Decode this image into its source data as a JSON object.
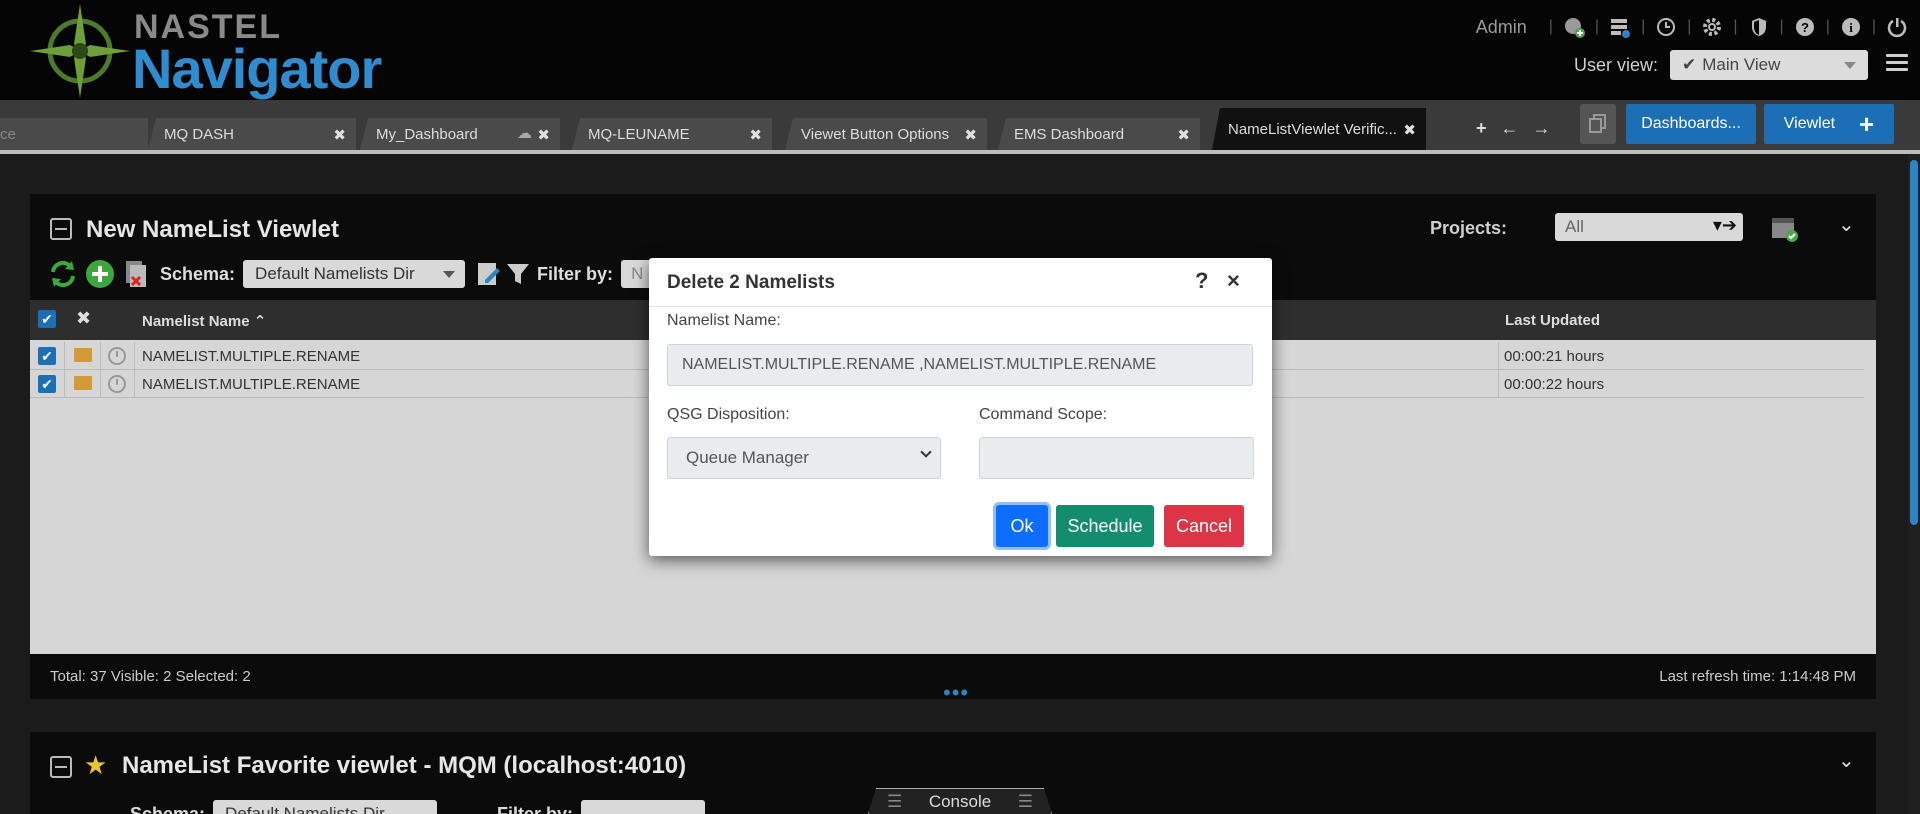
{
  "header": {
    "brand_top": "NASTEL",
    "brand_main": "Navigator",
    "admin_label": "Admin",
    "user_view_label": "User view:",
    "user_view_value": "Main View",
    "icons": [
      "globe-plus-icon",
      "server-icon",
      "clock-icon",
      "gear-icon",
      "shield-icon",
      "help-icon",
      "info-icon",
      "power-icon"
    ]
  },
  "tabs": [
    {
      "label": "ce",
      "closable": false
    },
    {
      "label": "MQ DASH",
      "closable": true
    },
    {
      "label": "My_Dashboard",
      "closable": true
    },
    {
      "label": "MQ-LEUNAME",
      "closable": true
    },
    {
      "label": "Viewet Button Options",
      "closable": true
    },
    {
      "label": "EMS Dashboard",
      "closable": true
    },
    {
      "label": "NameListViewlet Verific...",
      "closable": true,
      "active": true
    }
  ],
  "tab_actions": {
    "add": "+",
    "prev": "←",
    "next": "→",
    "dashboards_label": "Dashboards...",
    "viewlet_label": "Viewlet",
    "viewlet_plus": "+"
  },
  "viewlet": {
    "title": "New NameList Viewlet",
    "projects_label": "Projects:",
    "projects_value": "All",
    "schema_label": "Schema:",
    "schema_value": "Default Namelists Dir",
    "filter_label": "Filter by:",
    "filter_placeholder": "N",
    "columns": {
      "name": "Namelist Name ⌃",
      "updated": "Last Updated"
    },
    "rows": [
      {
        "name": "NAMELIST.MULTIPLE.RENAME",
        "updated": "00:00:21 hours"
      },
      {
        "name": "NAMELIST.MULTIPLE.RENAME",
        "updated": "00:00:22 hours"
      }
    ],
    "footer_left": "Total: 37 Visible: 2 Selected: 2",
    "footer_right": "Last refresh time: 1:14:48 PM"
  },
  "viewlet2": {
    "title": "NameList Favorite viewlet - MQM (localhost:4010)",
    "schema_label": "Schema:",
    "schema_value": "Default Namelists Dir",
    "filter_label": "Filter by:"
  },
  "console_label": "Console",
  "modal": {
    "title": "Delete 2 Namelists",
    "help": "?",
    "close": "×",
    "namelist_label": "Namelist Name:",
    "namelist_value": "NAMELIST.MULTIPLE.RENAME  ,NAMELIST.MULTIPLE.RENAME",
    "qsg_label": "QSG Disposition:",
    "qsg_value": "Queue Manager",
    "scope_label": "Command Scope:",
    "scope_value": "",
    "ok_label": "Ok",
    "schedule_label": "Schedule",
    "cancel_label": "Cancel"
  },
  "colors": {
    "brand_blue": "#2e8ccf",
    "primary": "#0d6efd",
    "success": "#138d6e",
    "danger": "#dc3545"
  }
}
